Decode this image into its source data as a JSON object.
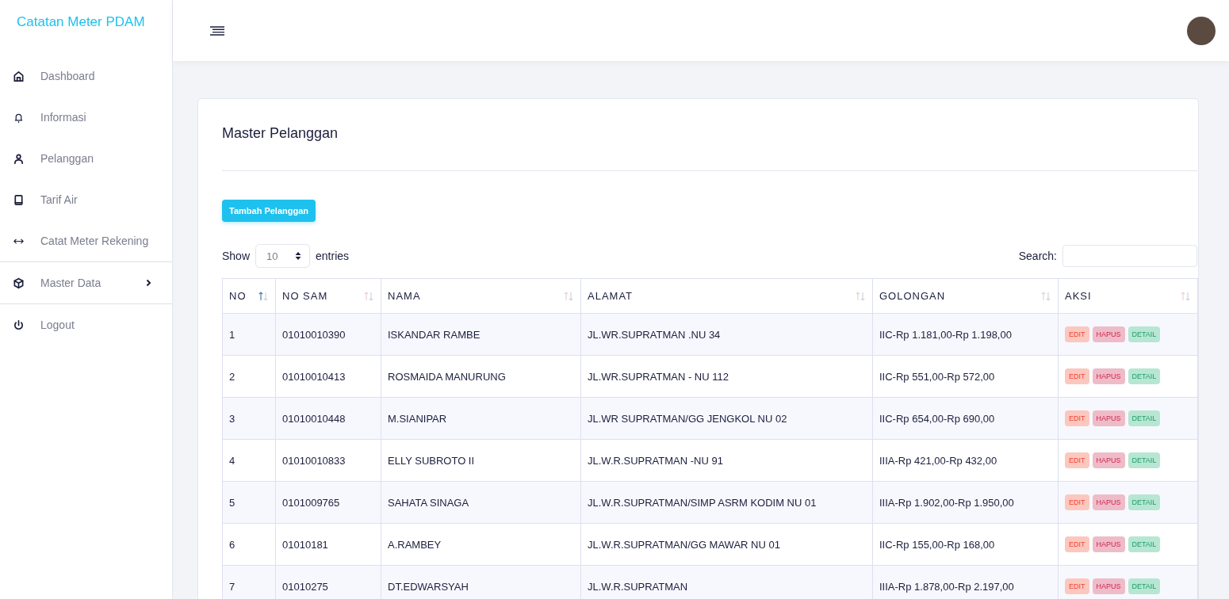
{
  "sidebar": {
    "brand": "Catatan Meter PDAM",
    "items": [
      {
        "label": "Dashboard",
        "kind": "link"
      },
      {
        "label": "Informasi",
        "kind": "link"
      },
      {
        "label": "Pelanggan",
        "kind": "link"
      },
      {
        "label": "Tarif Air",
        "kind": "link"
      },
      {
        "label": "Catat Meter Rekening",
        "kind": "link"
      },
      {
        "label": "Master Data",
        "kind": "submenu"
      },
      {
        "label": "Logout",
        "kind": "link"
      }
    ]
  },
  "card": {
    "title": "Master Pelanggan",
    "add_button": "Tambah Pelanggan",
    "length": {
      "before": "Show",
      "value": "10",
      "after": "entries"
    },
    "search": {
      "label": "Search:"
    },
    "table": {
      "columns": [
        {
          "label": "NO",
          "sorted": true
        },
        {
          "label": "NO SAM",
          "sorted": false
        },
        {
          "label": "NAMA",
          "sorted": false
        },
        {
          "label": "ALAMAT",
          "sorted": false
        },
        {
          "label": "GOLONGAN",
          "sorted": false
        },
        {
          "label": "AKSI",
          "sorted": false
        }
      ],
      "rows": [
        {
          "cells": [
            "1",
            "01010010390",
            "ISKANDAR RAMBE",
            "JL.WR.SUPRATMAN .NU 34",
            "IIC-Rp 1.181,00-Rp 1.198,00"
          ],
          "actions": [
            {
              "label": "EDIT",
              "kind": "edit"
            },
            {
              "label": "HAPUS",
              "kind": "delete"
            },
            {
              "label": "DETAIL",
              "kind": "detail"
            }
          ]
        },
        {
          "cells": [
            "2",
            "01010010413",
            "ROSMAIDA MANURUNG",
            "JL.WR.SUPRATMAN - NU 112",
            "IIC-Rp 551,00-Rp 572,00"
          ],
          "actions": [
            {
              "label": "EDIT",
              "kind": "edit"
            },
            {
              "label": "HAPUS",
              "kind": "delete"
            },
            {
              "label": "DETAIL",
              "kind": "detail"
            }
          ]
        },
        {
          "cells": [
            "3",
            "01010010448",
            "M.SIANIPAR",
            "JL.WR SUPRATMAN/GG JENGKOL NU 02",
            "IIC-Rp 654,00-Rp 690,00"
          ],
          "actions": [
            {
              "label": "EDIT",
              "kind": "edit"
            },
            {
              "label": "HAPUS",
              "kind": "delete"
            },
            {
              "label": "DETAIL",
              "kind": "detail"
            }
          ]
        },
        {
          "cells": [
            "4",
            "01010010833",
            "ELLY SUBROTO II",
            "JL.W.R.SUPRATMAN -NU 91",
            "IIIA-Rp 421,00-Rp 432,00"
          ],
          "actions": [
            {
              "label": "EDIT",
              "kind": "edit"
            },
            {
              "label": "HAPUS",
              "kind": "delete"
            },
            {
              "label": "DETAIL",
              "kind": "detail"
            }
          ]
        },
        {
          "cells": [
            "5",
            "0101009765",
            "SAHATA SINAGA",
            "JL.W.R.SUPRATMAN/SIMP ASRM KODIM NU 01",
            "IIIA-Rp 1.902,00-Rp 1.950,00"
          ],
          "actions": [
            {
              "label": "EDIT",
              "kind": "edit"
            },
            {
              "label": "HAPUS",
              "kind": "delete"
            },
            {
              "label": "DETAIL",
              "kind": "detail"
            }
          ]
        },
        {
          "cells": [
            "6",
            "01010181",
            "A.RAMBEY",
            "JL.W.R.SUPRATMAN/GG MAWAR NU 01",
            "IIC-Rp 155,00-Rp 168,00"
          ],
          "actions": [
            {
              "label": "EDIT",
              "kind": "edit"
            },
            {
              "label": "HAPUS",
              "kind": "delete"
            },
            {
              "label": "DETAIL",
              "kind": "detail"
            }
          ]
        },
        {
          "cells": [
            "7",
            "01010275",
            "DT.EDWARSYAH",
            "JL.W.R.SUPRATMAN",
            "IIIA-Rp 1.878,00-Rp 2.197,00"
          ],
          "actions": [
            {
              "label": "EDIT",
              "kind": "edit"
            },
            {
              "label": "HAPUS",
              "kind": "delete"
            },
            {
              "label": "DETAIL",
              "kind": "detail"
            }
          ]
        }
      ]
    }
  }
}
